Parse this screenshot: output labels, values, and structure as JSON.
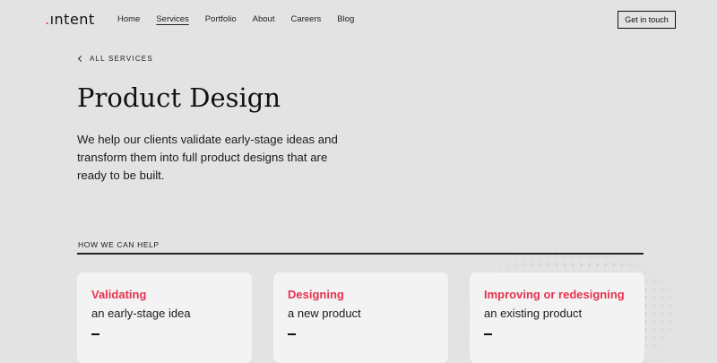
{
  "nav": {
    "logo_dot": ".",
    "logo_text": "ıntent",
    "links": [
      {
        "label": "Home"
      },
      {
        "label": "Services"
      },
      {
        "label": "Portfolio"
      },
      {
        "label": "About"
      },
      {
        "label": "Careers"
      },
      {
        "label": "Blog"
      }
    ],
    "active": "Services",
    "cta_label": "Get in touch"
  },
  "back_label": "ALL SERVICES",
  "page_title": "Product Design",
  "intro": "We help our clients validate early-stage ideas and transform them into full product designs that are ready to be built.",
  "section_label": "HOW WE CAN HELP",
  "cards": [
    {
      "title": "Validating",
      "subtitle": "an early-stage idea",
      "dash": "—"
    },
    {
      "title": "Designing",
      "subtitle": "a new product",
      "dash": "—"
    },
    {
      "title": "Improving or redesigning",
      "subtitle": "an existing product",
      "dash": "—"
    }
  ],
  "colors": {
    "accent": "#e6334f",
    "background": "#e3e3e3",
    "card": "#f3f3f3",
    "text": "#1a1a1a"
  },
  "icons": {
    "back": "chevron-left-icon"
  }
}
